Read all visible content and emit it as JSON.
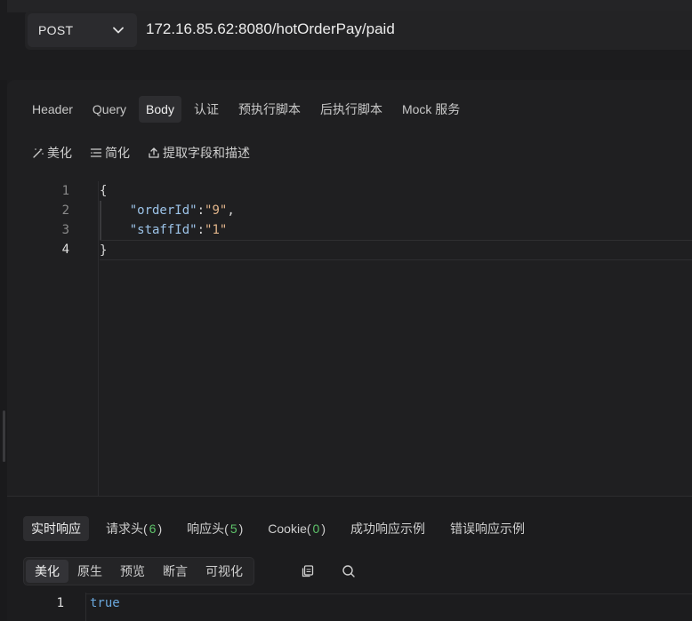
{
  "request": {
    "method": "POST",
    "url": "172.16.85.62:8080/hotOrderPay/paid"
  },
  "tabs": [
    {
      "label": "Header",
      "active": false
    },
    {
      "label": "Query",
      "active": false
    },
    {
      "label": "Body",
      "active": true
    },
    {
      "label": "认证",
      "active": false
    },
    {
      "label": "预执行脚本",
      "active": false
    },
    {
      "label": "后执行脚本",
      "active": false
    },
    {
      "label": "Mock 服务",
      "active": false
    }
  ],
  "toolbar": {
    "beautify": "美化",
    "simplify": "简化",
    "extract": "提取字段和描述"
  },
  "editor": {
    "line_numbers": [
      "1",
      "2",
      "3",
      "4"
    ],
    "current_line": 4,
    "lines": {
      "l1": "{",
      "l2_key": "\"orderId\"",
      "l2_colon": ":",
      "l2_value": "\"9\"",
      "l2_comma": ",",
      "l3_key": "\"staffId\"",
      "l3_colon": ":",
      "l3_value": "\"1\"",
      "l4": "}"
    }
  },
  "response": {
    "tabs": {
      "realtime": "实时响应",
      "req_headers": "请求头(",
      "req_headers_count": "6",
      "req_headers_close": ")",
      "resp_headers": "响应头(",
      "resp_headers_count": "5",
      "resp_headers_close": ")",
      "cookie": "Cookie(",
      "cookie_count": "0",
      "cookie_close": ")",
      "success_example": "成功响应示例",
      "error_example": "错误响应示例"
    },
    "views": [
      "美化",
      "原生",
      "预览",
      "断言",
      "可视化"
    ],
    "active_view": "美化",
    "line_number": "1",
    "body": "true"
  }
}
